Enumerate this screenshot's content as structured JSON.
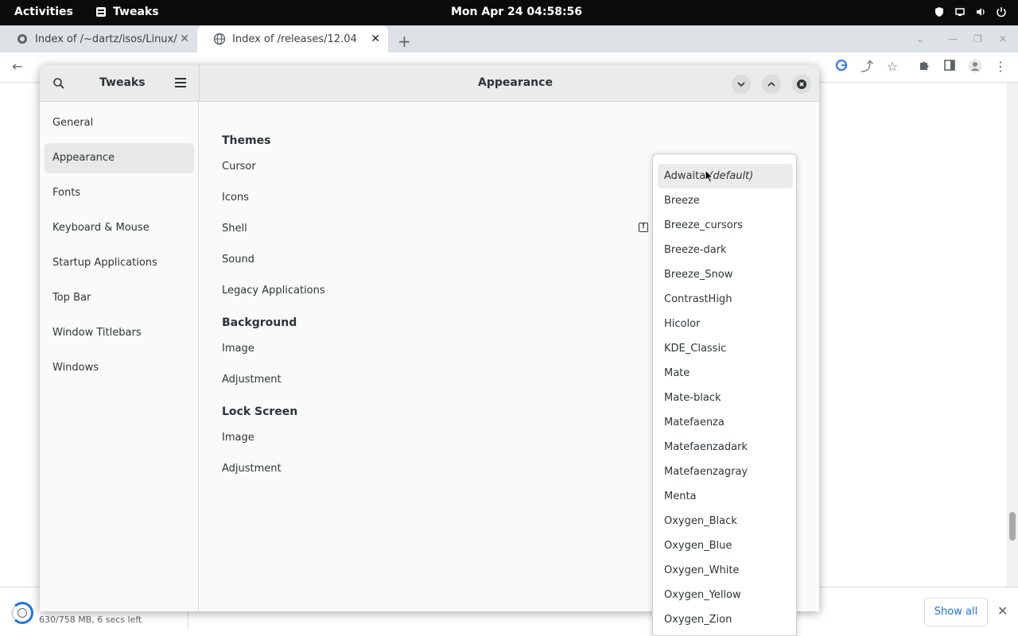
{
  "system_bar": {
    "activities": "Activities",
    "app_name": "Tweaks",
    "clock": "Mon Apr 24  04:58:56"
  },
  "browser": {
    "tabs": [
      {
        "title": "Index of /~dartz/isos/Linux/",
        "active": false
      },
      {
        "title": "Index of /releases/12.04",
        "active": true
      }
    ]
  },
  "download_bar": {
    "status": "630/758 MB, 6 secs left",
    "show_all": "Show all"
  },
  "tweaks": {
    "app_title": "Tweaks",
    "page_title": "Appearance",
    "sidebar": [
      {
        "label": "General"
      },
      {
        "label": "Appearance",
        "selected": true
      },
      {
        "label": "Fonts"
      },
      {
        "label": "Keyboard & Mouse"
      },
      {
        "label": "Startup Applications"
      },
      {
        "label": "Top Bar"
      },
      {
        "label": "Window Titlebars"
      },
      {
        "label": "Windows"
      }
    ],
    "sections": {
      "themes": {
        "title": "Themes",
        "rows": [
          "Cursor",
          "Icons",
          "Shell",
          "Sound",
          "Legacy Applications"
        ]
      },
      "background": {
        "title": "Background",
        "rows": [
          "Image",
          "Adjustment"
        ]
      },
      "lock_screen": {
        "title": "Lock Screen",
        "rows": [
          "Image",
          "Adjustment"
        ]
      }
    },
    "cursor_dropdown": {
      "first_item_name": "Adwaita",
      "first_item_suffix": "(default)",
      "items": [
        "Breeze",
        "Breeze_cursors",
        "Breeze-dark",
        "Breeze_Snow",
        "ContrastHigh",
        "Hicolor",
        "KDE_Classic",
        "Mate",
        "Mate-black",
        "Matefaenza",
        "Matefaenzadark",
        "Matefaenzagray",
        "Menta",
        "Oxygen_Black",
        "Oxygen_Blue",
        "Oxygen_White",
        "Oxygen_Yellow",
        "Oxygen_Zion"
      ]
    }
  },
  "colors": {
    "accent": "#1a73e8",
    "top_bar": "#0b0b0b",
    "selection": "#e8e8e8"
  }
}
